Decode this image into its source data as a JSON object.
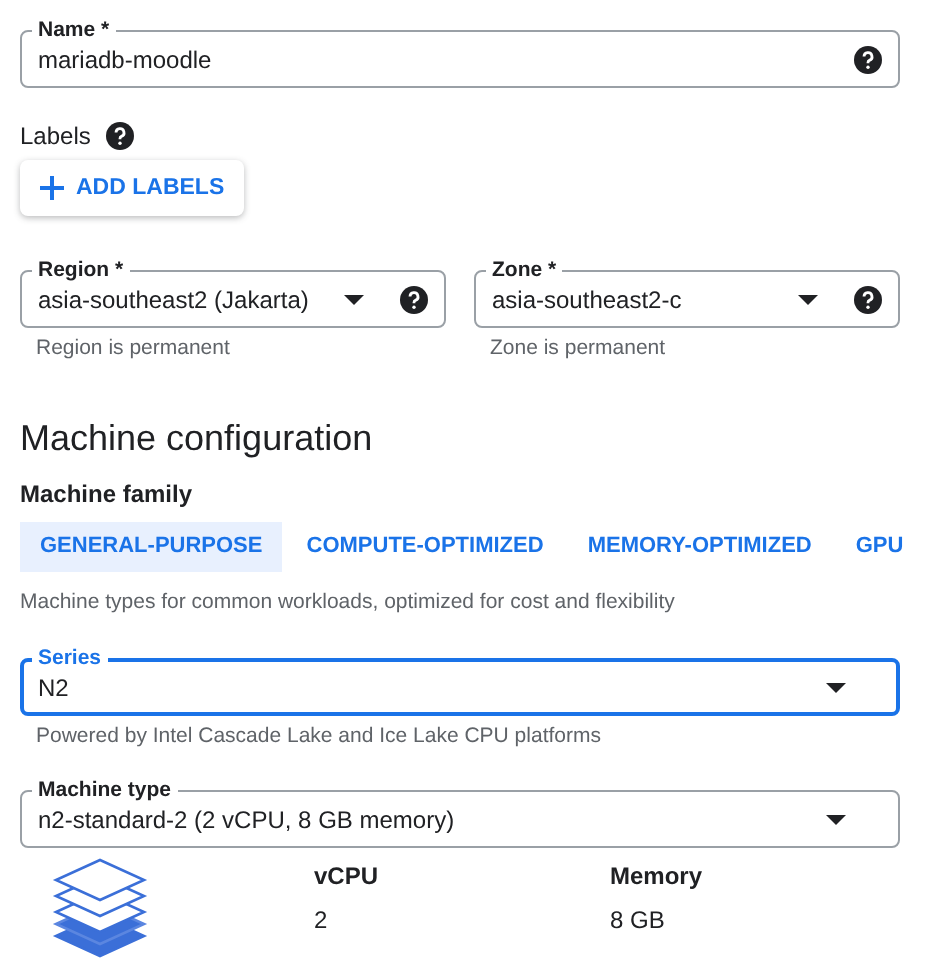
{
  "name_field": {
    "kind": "text",
    "label": "Name *",
    "value": "mariadb-moodle",
    "help": true,
    "focused": false
  },
  "labels": {
    "label": "Labels",
    "help": true,
    "button": "ADD LABELS"
  },
  "location": [
    {
      "kind": "select",
      "label": "Region *",
      "value": "asia-southeast2 (Jakarta)",
      "help": true,
      "focused": false,
      "hint": "Region is permanent"
    },
    {
      "kind": "select",
      "label": "Zone *",
      "value": "asia-southeast2-c",
      "help": true,
      "focused": false,
      "hint": "Zone is permanent"
    }
  ],
  "machine_configuration": {
    "title": "Machine configuration",
    "family_label": "Machine family",
    "tabs": [
      {
        "label": "GENERAL-PURPOSE",
        "selected": true
      },
      {
        "label": "COMPUTE-OPTIMIZED",
        "selected": false
      },
      {
        "label": "MEMORY-OPTIMIZED",
        "selected": false
      },
      {
        "label": "GPU",
        "selected": false
      }
    ],
    "description": "Machine types for common workloads, optimized for cost and flexibility",
    "series": {
      "kind": "select",
      "label": "Series",
      "value": "N2",
      "help": false,
      "focused": true,
      "hint": "Powered by Intel Cascade Lake and Ice Lake CPU platforms"
    },
    "machine_type": {
      "kind": "select",
      "label": "Machine type",
      "value": "n2-standard-2 (2 vCPU, 8 GB memory)",
      "help": false,
      "focused": false
    },
    "specs": [
      {
        "label": "vCPU",
        "value": "2"
      },
      {
        "label": "Memory",
        "value": "8 GB"
      }
    ]
  }
}
